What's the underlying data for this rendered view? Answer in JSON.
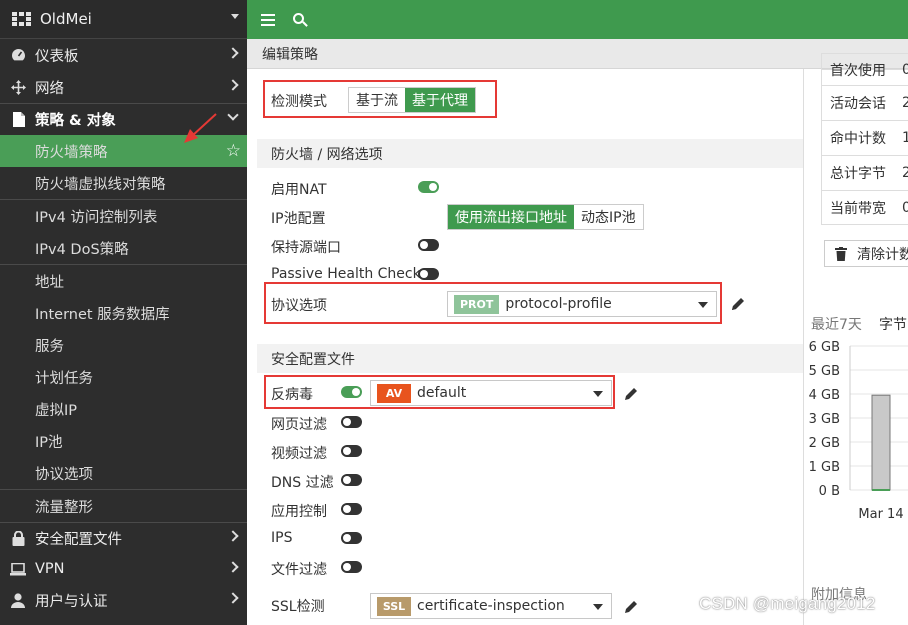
{
  "sidebar": {
    "title": "OldMei",
    "items": [
      {
        "label": "仪表板"
      },
      {
        "label": "网络"
      },
      {
        "label": "策略 & 对象"
      },
      {
        "label": "防火墙策略"
      },
      {
        "label": "防火墙虚拟线对策略"
      },
      {
        "label": "IPv4 访问控制列表"
      },
      {
        "label": "IPv4 DoS策略"
      },
      {
        "label": "地址"
      },
      {
        "label": "Internet 服务数据库"
      },
      {
        "label": "服务"
      },
      {
        "label": "计划任务"
      },
      {
        "label": "虚拟IP"
      },
      {
        "label": "IP池"
      },
      {
        "label": "协议选项"
      },
      {
        "label": "流量整形"
      },
      {
        "label": "安全配置文件"
      },
      {
        "label": "VPN"
      },
      {
        "label": "用户与认证"
      }
    ]
  },
  "header": {
    "page_title": "编辑策略"
  },
  "form": {
    "inspection_mode": {
      "label": "检测模式",
      "options": [
        "基于流",
        "基于代理"
      ],
      "selected": "基于代理"
    },
    "firewall_section": "防火墙 / 网络选项",
    "nat": {
      "label": "启用NAT",
      "on": true
    },
    "ip_pool": {
      "label": "IP池配置",
      "options": [
        "使用流出接口地址",
        "动态IP池"
      ],
      "selected": "使用流出接口地址"
    },
    "preserve_port": {
      "label": "保持源端口",
      "on": false
    },
    "passive_health": {
      "label": "Passive Health Check",
      "on": false
    },
    "protocol_options": {
      "label": "协议选项",
      "tag": "PROT",
      "value": "protocol-profile"
    },
    "security_section": "安全配置文件",
    "antivirus": {
      "label": "反病毒",
      "on": true,
      "tag": "AV",
      "value": "default"
    },
    "web_filter": {
      "label": "网页过滤",
      "on": false
    },
    "video_filter": {
      "label": "视频过滤",
      "on": false
    },
    "dns_filter": {
      "label": "DNS 过滤",
      "on": false
    },
    "app_control": {
      "label": "应用控制",
      "on": false
    },
    "ips": {
      "label": "IPS",
      "on": false
    },
    "file_filter": {
      "label": "文件过滤",
      "on": false
    },
    "ssl": {
      "label": "SSL检测",
      "tag": "SSL",
      "value": "certificate-inspection"
    }
  },
  "right_panel": {
    "stats": [
      "首次使用",
      "活动会话",
      "命中计数",
      "总计字节",
      "当前带宽"
    ],
    "stat_values": [
      "0",
      "2",
      "1",
      "2",
      "0"
    ],
    "clear_button": "清除计数",
    "chart_tabs": [
      "最近7天",
      "字节"
    ],
    "chart_y_ticks": [
      "6 GB",
      "5 GB",
      "4 GB",
      "3 GB",
      "2 GB",
      "1 GB",
      "0 B"
    ],
    "chart_x_label": "Mar 14",
    "extra_info": "附加信息"
  },
  "chart_data": {
    "type": "bar",
    "categories": [
      "Mar 14"
    ],
    "values": [
      3.95
    ],
    "xlabel": "",
    "ylabel": "",
    "ylim": [
      0,
      6
    ]
  },
  "watermark": "CSDN @meigang2012",
  "colors": {
    "accent": "#3f9a4e",
    "sidebar": "#2d2d2d",
    "highlight_box": "#e53935"
  }
}
